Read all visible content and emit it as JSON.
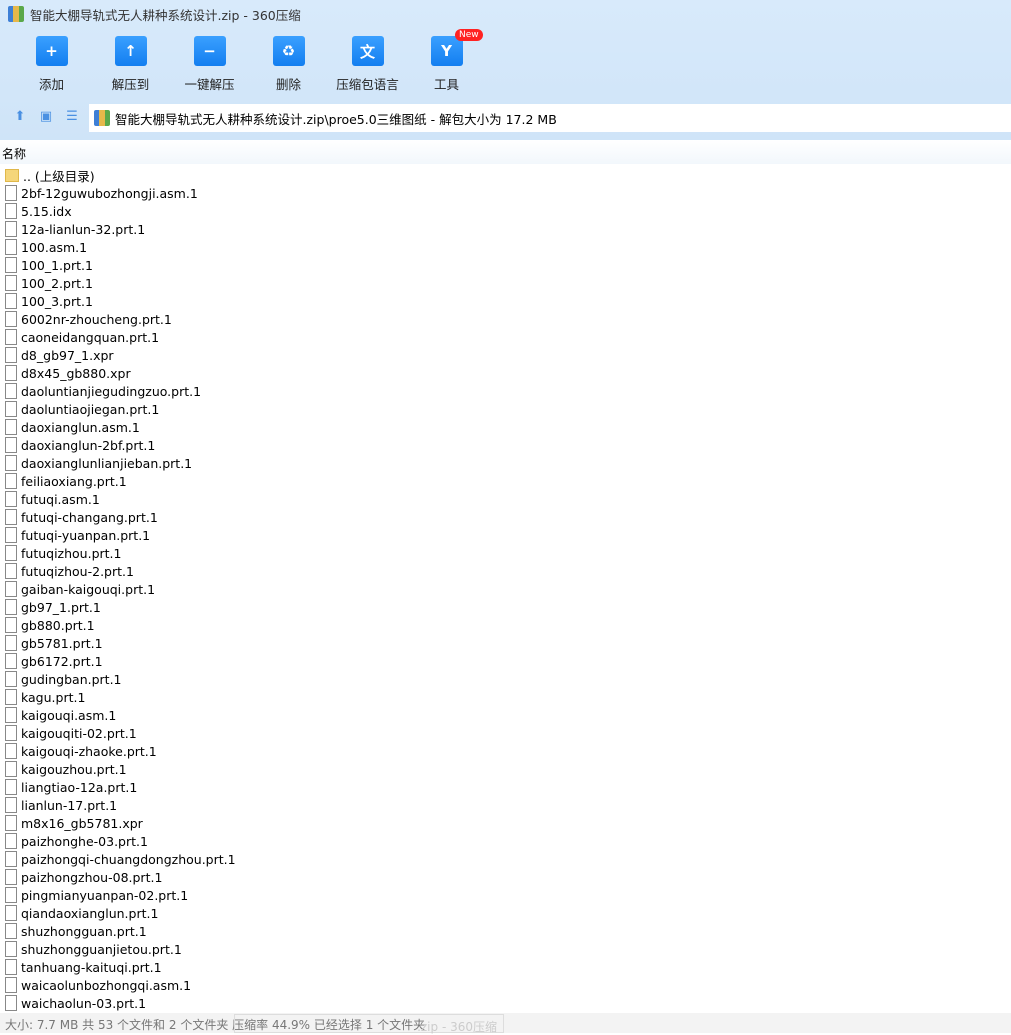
{
  "window": {
    "title": "智能大棚导轨式无人耕种系统设计.zip - 360压缩"
  },
  "toolbar": [
    {
      "label": "添加",
      "icon": "add-folder-icon",
      "glyph": "+"
    },
    {
      "label": "解压到",
      "icon": "extract-to-icon",
      "glyph": "↑"
    },
    {
      "label": "一键解压",
      "icon": "one-click-extract-icon",
      "glyph": "−"
    },
    {
      "label": "删除",
      "icon": "recycle-bin-icon",
      "glyph": "♻"
    },
    {
      "label": "压缩包语言",
      "icon": "language-icon",
      "glyph": "文"
    },
    {
      "label": "工具",
      "icon": "tools-icon",
      "glyph": "Y"
    }
  ],
  "new_badge": "New",
  "address": {
    "path": "智能大棚导轨式无人耕种系统设计.zip\\proe5.0三维图纸 - 解包大小为 17.2 MB"
  },
  "column_header": "名称",
  "parent_dir": ".. (上级目录)",
  "files": [
    "2bf-12guwubozhongji.asm.1",
    "5.15.idx",
    "12a-lianlun-32.prt.1",
    "100.asm.1",
    "100_1.prt.1",
    "100_2.prt.1",
    "100_3.prt.1",
    "6002nr-zhoucheng.prt.1",
    "caoneidangquan.prt.1",
    "d8_gb97_1.xpr",
    "d8x45_gb880.xpr",
    "daoluntianjiegudingzuo.prt.1",
    "daoluntiaojiegan.prt.1",
    "daoxianglun.asm.1",
    "daoxianglun-2bf.prt.1",
    "daoxianglunlianjieban.prt.1",
    "feiliaoxiang.prt.1",
    "futuqi.asm.1",
    "futuqi-changang.prt.1",
    "futuqi-yuanpan.prt.1",
    "futuqizhou.prt.1",
    "futuqizhou-2.prt.1",
    "gaiban-kaigouqi.prt.1",
    "gb97_1.prt.1",
    "gb880.prt.1",
    "gb5781.prt.1",
    "gb6172.prt.1",
    "gudingban.prt.1",
    "kagu.prt.1",
    "kaigouqi.asm.1",
    "kaigouqiti-02.prt.1",
    "kaigouqi-zhaoke.prt.1",
    "kaigouzhou.prt.1",
    "liangtiao-12a.prt.1",
    "lianlun-17.prt.1",
    "m8x16_gb5781.xpr",
    "paizhonghe-03.prt.1",
    "paizhongqi-chuangdongzhou.prt.1",
    "paizhongzhou-08.prt.1",
    "pingmianyuanpan-02.prt.1",
    "qiandaoxianglun.prt.1",
    "shuzhongguan.prt.1",
    "shuzhongguanjietou.prt.1",
    "tanhuang-kaituqi.prt.1",
    "waicaolunbozhongqi.asm.1",
    "waichaolun-03.prt.1"
  ],
  "status": "大小: 7.7 MB 共 53 个文件和 2 个文件夹 压缩率 44.9% 已经选择 1 个文件夹",
  "ghost_tooltip": ".zip - 360压缩"
}
